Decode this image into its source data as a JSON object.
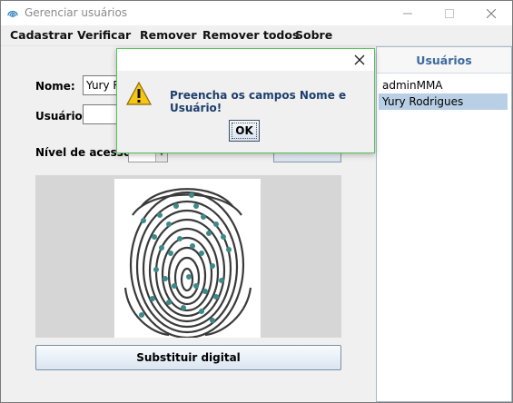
{
  "window": {
    "title": "Gerenciar usuários"
  },
  "menu": [
    "Cadastrar",
    "Verificar",
    "Remover",
    "Remover todos",
    "Sobre"
  ],
  "form": {
    "name_label": "Nome:",
    "name_value": "Yury R",
    "user_label": "Usuário:",
    "user_value": "",
    "level_label": "Nível de acesso:"
  },
  "fingerprint": {
    "replace_label": "Substituir digital"
  },
  "users_panel": {
    "header": "Usuários",
    "items": [
      {
        "label": "adminMMA",
        "selected": false
      },
      {
        "label": "Yury Rodrigues",
        "selected": true
      }
    ]
  },
  "dialog": {
    "message": "Preencha os campos Nome e Usuário!",
    "ok_label": "OK",
    "icon": "warning-icon"
  },
  "colors": {
    "selection": "#b8cfe5",
    "header_text": "#3c6a9a",
    "dialog_border": "#58c258",
    "minutiae": "#3d8a8a"
  }
}
